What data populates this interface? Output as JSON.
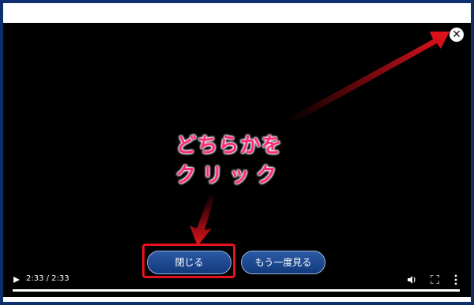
{
  "player": {
    "close_icon": "close-icon",
    "annotation": {
      "line1": "どちらかを",
      "line2": "クリック"
    },
    "buttons": {
      "close_label": "閉じる",
      "replay_label": "もう一度見る"
    },
    "controls": {
      "time": "2:33 / 2:33",
      "progress": 1.0,
      "icons": [
        "play-icon",
        "volume-icon",
        "fullscreen-icon",
        "more-icon"
      ]
    }
  },
  "colors": {
    "frame": "#0e2f6e",
    "annotation_text": "#ff2a7a",
    "arrow_red": "#e8121c",
    "button_blue": "#1d4a92"
  }
}
